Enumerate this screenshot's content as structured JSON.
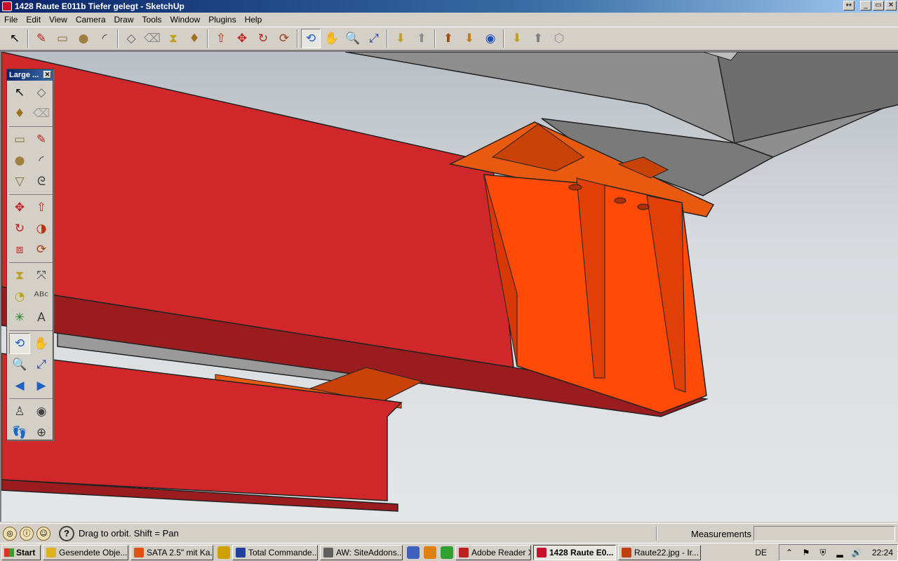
{
  "window": {
    "title": "1428 Raute E011b Tiefer gelegt - SketchUp",
    "buttons": {
      "restore_small": "↔",
      "minimize": "_",
      "maximize": "▭",
      "close": "✕"
    }
  },
  "menu": [
    "File",
    "Edit",
    "View",
    "Camera",
    "Draw",
    "Tools",
    "Window",
    "Plugins",
    "Help"
  ],
  "toolbar": {
    "tools": [
      {
        "name": "select",
        "glyph": "↖",
        "color": "#000000"
      },
      {
        "name": "pencil",
        "glyph": "✎",
        "color": "#c02020"
      },
      {
        "name": "rectangle",
        "glyph": "▭",
        "color": "#8a6a30"
      },
      {
        "name": "circle",
        "glyph": "●",
        "color": "#a08040"
      },
      {
        "name": "arc",
        "glyph": "◜",
        "color": "#404040"
      },
      {
        "name": "make-component",
        "glyph": "◇",
        "color": "#606060"
      },
      {
        "name": "eraser",
        "glyph": "⌫",
        "color": "#909090"
      },
      {
        "name": "tape-measure",
        "glyph": "⧗",
        "color": "#c0a020"
      },
      {
        "name": "paint-bucket",
        "glyph": "♦",
        "color": "#a07020"
      },
      {
        "name": "push-pull",
        "glyph": "⇧",
        "color": "#c03010"
      },
      {
        "name": "move",
        "glyph": "✥",
        "color": "#c02020"
      },
      {
        "name": "rotate",
        "glyph": "↻",
        "color": "#c02020"
      },
      {
        "name": "offset",
        "glyph": "⟳",
        "color": "#a04010"
      },
      {
        "name": "orbit",
        "glyph": "⟲",
        "color": "#2060c0",
        "active": true
      },
      {
        "name": "pan",
        "glyph": "✋",
        "color": "#606060"
      },
      {
        "name": "zoom",
        "glyph": "🔍",
        "color": "#2040a0"
      },
      {
        "name": "zoom-extents",
        "glyph": "⤢",
        "color": "#2040a0"
      },
      {
        "name": "get-models",
        "glyph": "⬇",
        "color": "#c0a020"
      },
      {
        "name": "share-model",
        "glyph": "⬆",
        "color": "#909090"
      },
      {
        "name": "share-component",
        "glyph": "⬆",
        "color": "#a05010"
      },
      {
        "name": "get-photo-texture",
        "glyph": "⬇",
        "color": "#c08010"
      },
      {
        "name": "preview-google-earth",
        "glyph": "◉",
        "color": "#2050c0"
      },
      {
        "name": "component-options",
        "glyph": "⬇",
        "color": "#c0a020"
      },
      {
        "name": "component-attributes",
        "glyph": "⬆",
        "color": "#808080"
      },
      {
        "name": "extension-warehouse",
        "glyph": "⬡",
        "color": "#909090"
      }
    ]
  },
  "palette": {
    "title": "Large ...",
    "close": "✕",
    "tools": [
      {
        "name": "select",
        "glyph": "↖",
        "color": "#000000"
      },
      {
        "name": "make-component",
        "glyph": "◇",
        "color": "#606060"
      },
      {
        "name": "paint-bucket",
        "glyph": "♦",
        "color": "#a07020"
      },
      {
        "name": "eraser",
        "glyph": "⌫",
        "color": "#a0a0a0"
      },
      {
        "name": "gap1",
        "glyph": "",
        "color": ""
      },
      {
        "name": "rectangle",
        "glyph": "▭",
        "color": "#8a6a30"
      },
      {
        "name": "line",
        "glyph": "✎",
        "color": "#c02020"
      },
      {
        "name": "circle",
        "glyph": "●",
        "color": "#a08040"
      },
      {
        "name": "arc",
        "glyph": "◜",
        "color": "#404040"
      },
      {
        "name": "polygon",
        "glyph": "▽",
        "color": "#8a6a30"
      },
      {
        "name": "freehand",
        "glyph": "ᘓ",
        "color": "#404040"
      },
      {
        "name": "gap2",
        "glyph": "",
        "color": ""
      },
      {
        "name": "move",
        "glyph": "✥",
        "color": "#c02020"
      },
      {
        "name": "push-pull",
        "glyph": "⇧",
        "color": "#c03010"
      },
      {
        "name": "rotate",
        "glyph": "↻",
        "color": "#c02020"
      },
      {
        "name": "follow-me",
        "glyph": "◑",
        "color": "#c03010"
      },
      {
        "name": "scale",
        "glyph": "⧈",
        "color": "#c02020"
      },
      {
        "name": "offset",
        "glyph": "⟳",
        "color": "#a04010"
      },
      {
        "name": "gap3",
        "glyph": "",
        "color": ""
      },
      {
        "name": "tape-measure",
        "glyph": "⧗",
        "color": "#c0a020"
      },
      {
        "name": "dimension",
        "glyph": "⤧",
        "color": "#404040"
      },
      {
        "name": "protractor",
        "glyph": "◔",
        "color": "#c0a020"
      },
      {
        "name": "text",
        "glyph": "ᴬᴮᶜ",
        "color": "#404040"
      },
      {
        "name": "axes",
        "glyph": "✳",
        "color": "#208020"
      },
      {
        "name": "3d-text",
        "glyph": "A",
        "color": "#404040"
      },
      {
        "name": "gap4",
        "glyph": "",
        "color": ""
      },
      {
        "name": "orbit",
        "glyph": "⟲",
        "color": "#2060c0",
        "active": true
      },
      {
        "name": "pan",
        "glyph": "✋",
        "color": "#606060"
      },
      {
        "name": "zoom",
        "glyph": "🔍",
        "color": "#2040a0"
      },
      {
        "name": "zoom-window",
        "glyph": "⤢",
        "color": "#2040a0"
      },
      {
        "name": "previous",
        "glyph": "◀",
        "color": "#2060c0"
      },
      {
        "name": "next",
        "glyph": "▶",
        "color": "#2060c0"
      },
      {
        "name": "gap5",
        "glyph": "",
        "color": ""
      },
      {
        "name": "position-camera",
        "glyph": "♙",
        "color": "#404040"
      },
      {
        "name": "look-around",
        "glyph": "◉",
        "color": "#404040"
      },
      {
        "name": "walk",
        "glyph": "👣",
        "color": "#202020"
      },
      {
        "name": "section-plane",
        "glyph": "⊕",
        "color": "#404040"
      }
    ]
  },
  "status": {
    "text": "Drag to orbit.  Shift = Pan",
    "measurements_label": "Measurements",
    "icons": [
      "geo-location",
      "credits",
      "user"
    ]
  },
  "taskbar": {
    "start": "Start",
    "items": [
      {
        "label": "Gesendete Obje...",
        "color": "#e0b020"
      },
      {
        "label": "SATA 2.5\" mit Ka...",
        "color": "#e05010"
      },
      {
        "label": "",
        "color": "#d0a000"
      },
      {
        "label": "Total Commande...",
        "color": "#2040a0"
      },
      {
        "label": "AW: SiteAddons....",
        "color": "#606060"
      },
      {
        "label": "",
        "color": "#4060c0"
      },
      {
        "label": "",
        "color": "#e08010"
      },
      {
        "label": "",
        "color": "#30a030"
      },
      {
        "label": "Adobe Reader X",
        "color": "#c02020"
      },
      {
        "label": "1428 Raute E0...",
        "color": "#c8102e",
        "active": true
      },
      {
        "label": "Raute22.jpg - Ir...",
        "color": "#c04010"
      }
    ],
    "lang": "DE",
    "clock": "22:24"
  }
}
